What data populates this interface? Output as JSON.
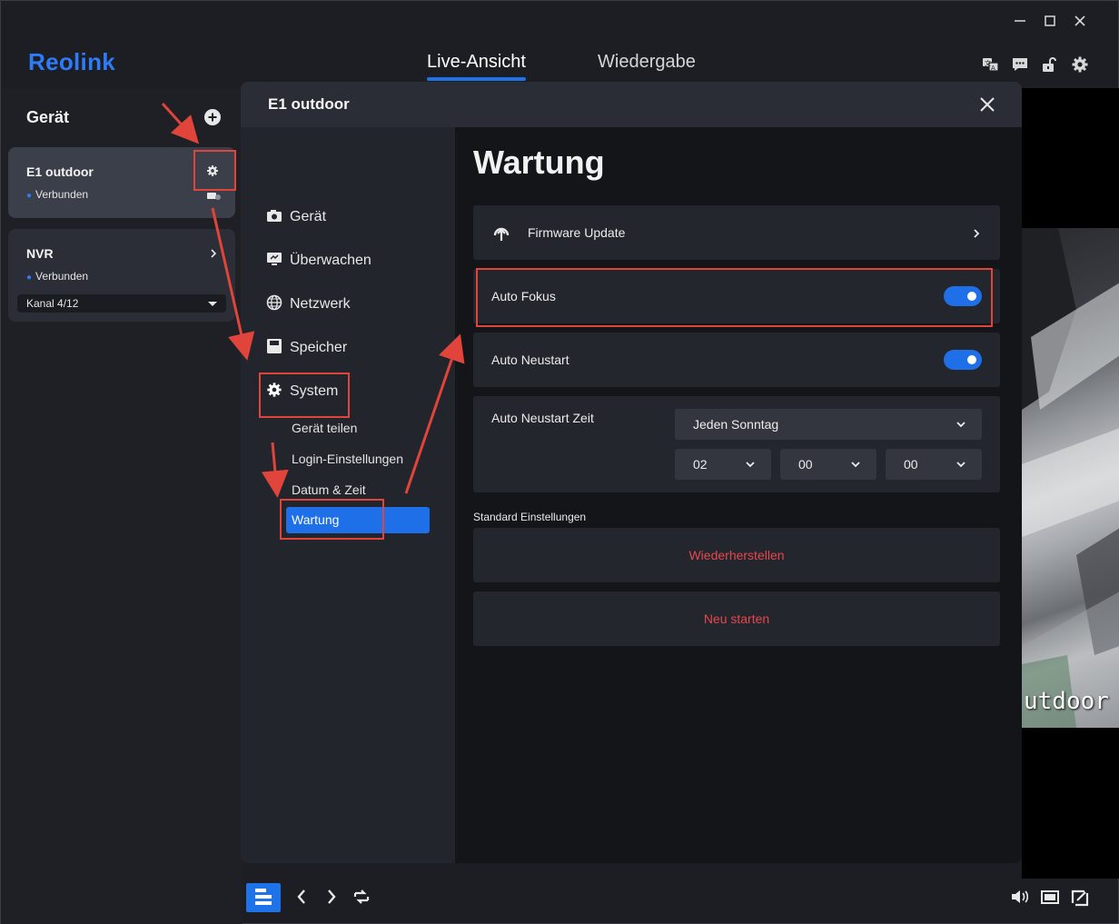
{
  "window": {
    "controls": [
      "minimize-icon",
      "maximize-icon",
      "close-icon"
    ]
  },
  "header": {
    "logo": "Reolink",
    "tabs": [
      {
        "label": "Live-Ansicht",
        "active": true
      },
      {
        "label": "Wiedergabe",
        "active": false
      }
    ],
    "right_icons": [
      "translate-icon",
      "chat-icon",
      "lock-icon",
      "gear-icon"
    ]
  },
  "sidebar": {
    "title": "Gerät",
    "devices": [
      {
        "name": "E1 outdoor",
        "status": "Verbunden",
        "selected": true
      },
      {
        "name": "NVR",
        "status": "Verbunden",
        "channel": "Kanal 4/12"
      }
    ]
  },
  "dialog": {
    "title": "E1 outdoor",
    "menu": [
      {
        "label": "Gerät",
        "icon": "camera-icon"
      },
      {
        "label": "Überwachen",
        "icon": "monitor-icon"
      },
      {
        "label": "Netzwerk",
        "icon": "globe-icon"
      },
      {
        "label": "Speicher",
        "icon": "storage-icon"
      },
      {
        "label": "System",
        "icon": "gear-icon"
      }
    ],
    "submenu": [
      {
        "label": "Gerät teilen"
      },
      {
        "label": "Login-Einstellungen"
      },
      {
        "label": "Datum & Zeit"
      },
      {
        "label": "Wartung",
        "active": true
      }
    ],
    "content": {
      "title": "Wartung",
      "firmware_update": "Firmware Update",
      "auto_focus": {
        "label": "Auto Fokus",
        "enabled": true
      },
      "auto_restart": {
        "label": "Auto Neustart",
        "enabled": true
      },
      "restart_time": {
        "label": "Auto Neustart Zeit",
        "day": "Jeden Sonntag",
        "hour": "02",
        "minute": "00",
        "second": "00"
      },
      "defaults_section": "Standard Einstellungen",
      "restore_button": "Wiederherstellen",
      "reboot_button": "Neu starten"
    }
  },
  "video": {
    "label": "utdoor"
  },
  "colors": {
    "accent": "#1e73e8",
    "danger": "#e5484d",
    "highlight": "#e0443a"
  }
}
